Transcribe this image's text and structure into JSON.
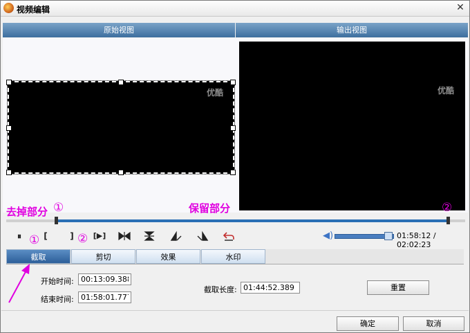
{
  "window": {
    "title": "视频编辑",
    "close": "✕"
  },
  "views": {
    "original": "原始视图",
    "output": "输出视图",
    "watermark": "优酷"
  },
  "annotations": {
    "remove_part": "去掉部分",
    "keep_part": "保留部分",
    "circle_1": "①",
    "circle_2": "②"
  },
  "controls": {
    "pause": "⏸",
    "mark_in": "[",
    "mark_out": "]",
    "play_selection": "[▶]",
    "time": "01:58:12 / 02:02:23"
  },
  "tabs": [
    "截取",
    "剪切",
    "效果",
    "水印"
  ],
  "trim": {
    "start_label": "开始时间:",
    "start_value": "00:13:09.388",
    "end_label": "结束时间:",
    "end_value": "01:58:01.777",
    "length_label": "截取长度:",
    "length_value": "01:44:52.389",
    "reset": "重置"
  },
  "footer": {
    "ok": "确定",
    "cancel": "取消"
  },
  "colors": {
    "accent": "#2a6fb5",
    "annotation": "#e000e0"
  }
}
